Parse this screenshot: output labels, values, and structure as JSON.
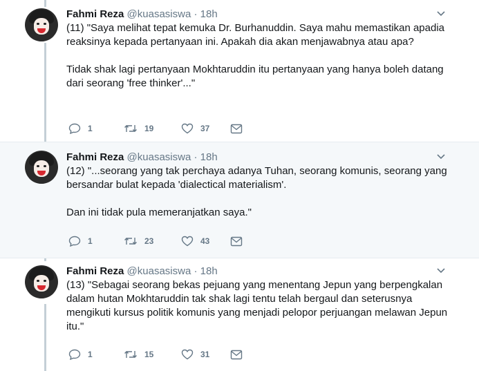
{
  "colors": {
    "thread_line": "#c4cfd6",
    "highlight_bg": "#f5f8fa",
    "muted_text": "#657786",
    "accent_red": "#d6282f"
  },
  "tweets": [
    {
      "name": "Fahmi Reza",
      "handle": "@kuasasiswa",
      "dot": "·",
      "time": "18h",
      "paragraphs": [
        "(11) \"Saya melihat tepat kemuka Dr. Burhanuddin. Saya mahu memastikan apadia reaksinya kepada pertanyaan ini. Apakah dia akan menjawabnya atau apa?",
        "Tidak shak lagi pertanyaan Mokhtaruddin itu pertanyaan yang hanya boleh datang dari seorang 'free thinker'...\""
      ],
      "replies": "1",
      "retweets": "19",
      "likes": "37",
      "icons": [
        "reply-icon",
        "retweet-icon",
        "like-icon",
        "dm-icon",
        "caret-down-icon"
      ]
    },
    {
      "name": "Fahmi Reza",
      "handle": "@kuasasiswa",
      "dot": "·",
      "time": "18h",
      "paragraphs": [
        "(12) \"...seorang yang tak perchaya adanya Tuhan, seorang komunis, seorang yang bersandar bulat kepada 'dialectical materialism'.",
        "Dan ini tidak pula memeranjatkan saya.\""
      ],
      "replies": "1",
      "retweets": "23",
      "likes": "43",
      "icons": [
        "reply-icon",
        "retweet-icon",
        "like-icon",
        "dm-icon",
        "caret-down-icon"
      ]
    },
    {
      "name": "Fahmi Reza",
      "handle": "@kuasasiswa",
      "dot": "·",
      "time": "18h",
      "paragraphs": [
        "(13) \"Sebagai seorang bekas pejuang yang menentang Jepun yang berpengkalan dalam hutan Mokhtaruddin tak shak lagi tentu telah bergaul dan seterusnya mengikuti kursus politik komunis yang menjadi pelopor perjuangan melawan Jepun itu.\""
      ],
      "replies": "1",
      "retweets": "15",
      "likes": "31",
      "icons": [
        "reply-icon",
        "retweet-icon",
        "like-icon",
        "dm-icon",
        "caret-down-icon"
      ]
    }
  ]
}
